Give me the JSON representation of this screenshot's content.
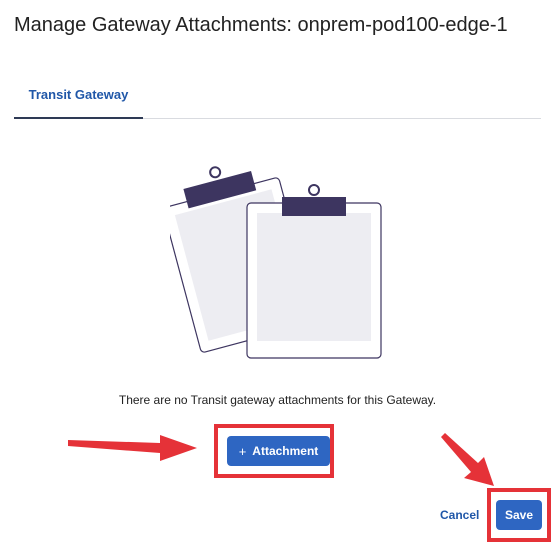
{
  "dialog": {
    "title": "Manage Gateway Attachments: onprem-pod100-edge-1"
  },
  "tabs": [
    {
      "label": "Transit Gateway",
      "active": true
    }
  ],
  "empty_state": {
    "illustration": "clipboards-illustration",
    "message": "There are no Transit gateway attachments for this Gateway."
  },
  "actions": {
    "add_icon": "+",
    "add_label": "Attachment",
    "cancel_label": "Cancel",
    "save_label": "Save"
  },
  "colors": {
    "primary": "#2e66c2",
    "link": "#2057a8",
    "annotation_red": "#e53238",
    "clip": "#3d3560"
  }
}
